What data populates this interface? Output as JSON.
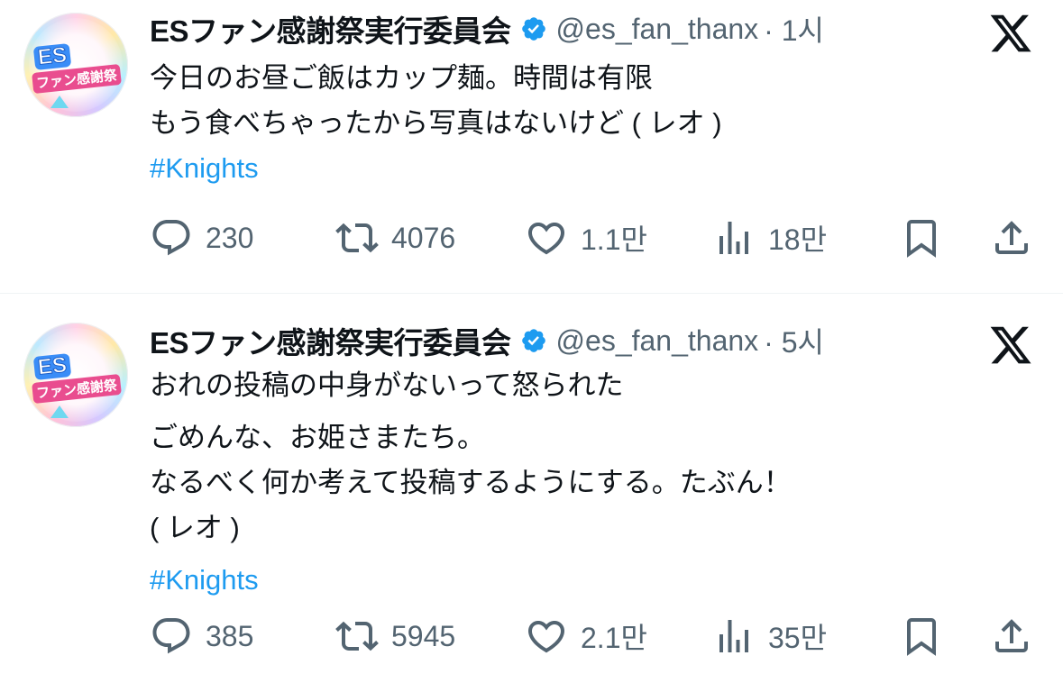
{
  "colors": {
    "accent": "#1d9bf0",
    "muted": "#536471",
    "text": "#0f1419"
  },
  "tweets": [
    {
      "author_name": "ESファン感謝祭実行委員会",
      "handle": "@es_fan_thanx",
      "time": "· 1시",
      "lines": [
        "今日のお昼ご飯はカップ麺。時間は有限",
        "もう食べちゃったから写真はないけど ( レオ )"
      ],
      "hashtag": "#Knights",
      "replies": "230",
      "reposts": "4076",
      "likes": "1.1만",
      "views": "18만"
    },
    {
      "author_name": "ESファン感謝祭実行委員会",
      "handle": "@es_fan_thanx",
      "time": "· 5시",
      "lines": [
        "おれの投稿の中身がないって怒られた",
        "",
        "ごめんな、お姫さまたち。",
        "なるべく何か考えて投稿するようにする。たぶん！",
        "( レオ )"
      ],
      "hashtag": "#Knights",
      "replies": "385",
      "reposts": "5945",
      "likes": "2.1만",
      "views": "35만"
    }
  ],
  "avatar": {
    "logo_text": "ES",
    "logo_sub": "ファン感謝祭"
  }
}
